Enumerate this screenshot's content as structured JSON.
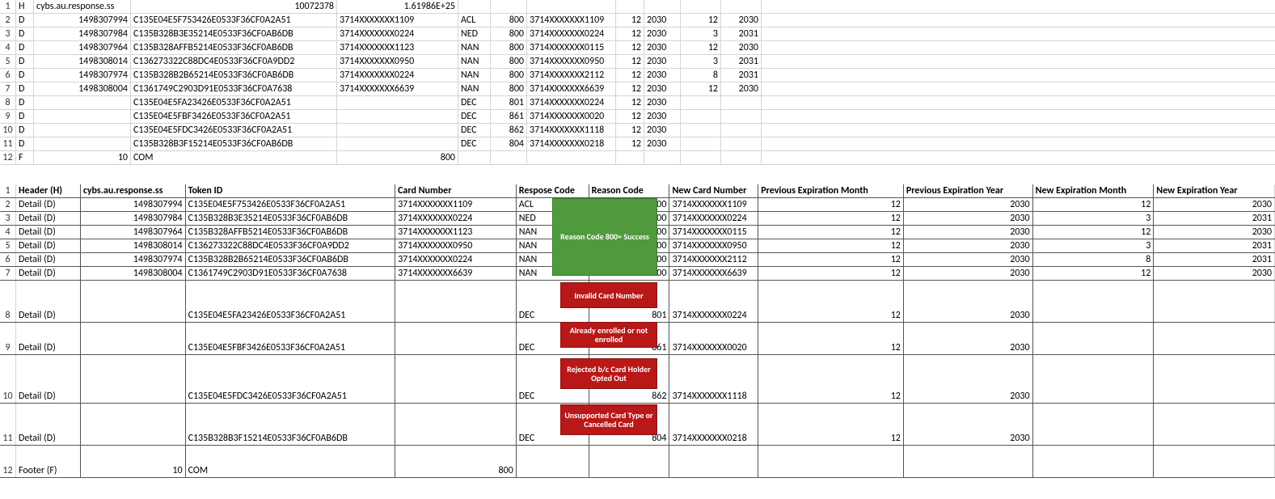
{
  "top": {
    "header": {
      "c1": "H",
      "c2": "cybs.au.response.ss",
      "c3": "10072378",
      "c4": "1.61986E+25"
    },
    "rows": [
      {
        "n": "2",
        "c1": "D",
        "c2": "1498307994",
        "c3": "C135E04E5F753426E0533F36CF0A2A51",
        "c4": "3714XXXXXXX1109",
        "c5": "ACL",
        "c6": "800",
        "c7": "3714XXXXXXX1109",
        "c8": "12",
        "c9": "2030",
        "c10": "12",
        "c11": "2030"
      },
      {
        "n": "3",
        "c1": "D",
        "c2": "1498307984",
        "c3": "C135B328B3E35214E0533F36CF0AB6DB",
        "c4": "3714XXXXXXX0224",
        "c5": "NED",
        "c6": "800",
        "c7": "3714XXXXXXX0224",
        "c8": "12",
        "c9": "2030",
        "c10": "3",
        "c11": "2031"
      },
      {
        "n": "4",
        "c1": "D",
        "c2": "1498307964",
        "c3": "C135B328AFFB5214E0533F36CF0AB6DB",
        "c4": "3714XXXXXXX1123",
        "c5": "NAN",
        "c6": "800",
        "c7": "3714XXXXXXX0115",
        "c8": "12",
        "c9": "2030",
        "c10": "12",
        "c11": "2030"
      },
      {
        "n": "5",
        "c1": "D",
        "c2": "1498308014",
        "c3": "C136273322C88DC4E0533F36CF0A9DD2",
        "c4": "3714XXXXXXX0950",
        "c5": "NAN",
        "c6": "800",
        "c7": "3714XXXXXXX0950",
        "c8": "12",
        "c9": "2030",
        "c10": "3",
        "c11": "2031"
      },
      {
        "n": "6",
        "c1": "D",
        "c2": "1498307974",
        "c3": "C135B328B2B65214E0533F36CF0AB6DB",
        "c4": "3714XXXXXXX0224",
        "c5": "NAN",
        "c6": "800",
        "c7": "3714XXXXXXX2112",
        "c8": "12",
        "c9": "2030",
        "c10": "8",
        "c11": "2031"
      },
      {
        "n": "7",
        "c1": "D",
        "c2": "1498308004",
        "c3": "C1361749C2903D91E0533F36CF0A7638",
        "c4": "3714XXXXXXX6639",
        "c5": "NAN",
        "c6": "800",
        "c7": "3714XXXXXXX6639",
        "c8": "12",
        "c9": "2030",
        "c10": "12",
        "c11": "2030"
      },
      {
        "n": "8",
        "c1": "D",
        "c2": "",
        "c3": "C135E04E5FA23426E0533F36CF0A2A51",
        "c4": "",
        "c5": "DEC",
        "c6": "801",
        "c7": "3714XXXXXXX0224",
        "c8": "12",
        "c9": "2030",
        "c10": "",
        "c11": ""
      },
      {
        "n": "9",
        "c1": "D",
        "c2": "",
        "c3": "C135E04E5FBF3426E0533F36CF0A2A51",
        "c4": "",
        "c5": "DEC",
        "c6": "861",
        "c7": "3714XXXXXXX0020",
        "c8": "12",
        "c9": "2030",
        "c10": "",
        "c11": ""
      },
      {
        "n": "10",
        "c1": "D",
        "c2": "",
        "c3": "C135E04E5FDC3426E0533F36CF0A2A51",
        "c4": "",
        "c5": "DEC",
        "c6": "862",
        "c7": "3714XXXXXXX1118",
        "c8": "12",
        "c9": "2030",
        "c10": "",
        "c11": ""
      },
      {
        "n": "11",
        "c1": "D",
        "c2": "",
        "c3": "C135B328B3F15214E0533F36CF0AB6DB",
        "c4": "",
        "c5": "DEC",
        "c6": "804",
        "c7": "3714XXXXXXX0218",
        "c8": "12",
        "c9": "2030",
        "c10": "",
        "c11": ""
      },
      {
        "n": "12",
        "c1": "F",
        "c2": "10",
        "c3": "COM",
        "c4": "800",
        "c5": "",
        "c6": "",
        "c7": "",
        "c8": "",
        "c9": "",
        "c10": "",
        "c11": ""
      }
    ]
  },
  "bottom": {
    "headers": {
      "c1": "Header (H)",
      "c2": "cybs.au.response.ss",
      "c3": "Token ID",
      "c4": "Card Number",
      "c5": "Respose Code",
      "c6": "Reason Code",
      "c7": "New Card Number",
      "c8": "Previous Expiration Month",
      "c9": "Previous Expiration Year",
      "c10": "New Expiration Month",
      "c11": "New Expiration Year"
    },
    "rows": [
      {
        "n": "2",
        "c1": "Detail (D)",
        "c2": "1498307994",
        "c3": "C135E04E5F753426E0533F36CF0A2A51",
        "c4": "3714XXXXXXX1109",
        "c5": "ACL",
        "c6": "800",
        "c7": "3714XXXXXXX1109",
        "c8": "12",
        "c9": "2030",
        "c10": "12",
        "c11": "2030"
      },
      {
        "n": "3",
        "c1": "Detail (D)",
        "c2": "1498307984",
        "c3": "C135B328B3E35214E0533F36CF0AB6DB",
        "c4": "3714XXXXXXX0224",
        "c5": "NED",
        "c6": "800",
        "c7": "3714XXXXXXX0224",
        "c8": "12",
        "c9": "2030",
        "c10": "3",
        "c11": "2031"
      },
      {
        "n": "4",
        "c1": "Detail (D)",
        "c2": "1498307964",
        "c3": "C135B328AFFB5214E0533F36CF0AB6DB",
        "c4": "3714XXXXXXX1123",
        "c5": "NAN",
        "c6": "800",
        "c7": "3714XXXXXXX0115",
        "c8": "12",
        "c9": "2030",
        "c10": "12",
        "c11": "2030"
      },
      {
        "n": "5",
        "c1": "Detail (D)",
        "c2": "1498308014",
        "c3": "C136273322C88DC4E0533F36CF0A9DD2",
        "c4": "3714XXXXXXX0950",
        "c5": "NAN",
        "c6": "800",
        "c7": "3714XXXXXXX0950",
        "c8": "12",
        "c9": "2030",
        "c10": "3",
        "c11": "2031"
      },
      {
        "n": "6",
        "c1": "Detail (D)",
        "c2": "1498307974",
        "c3": "C135B328B2B65214E0533F36CF0AB6DB",
        "c4": "3714XXXXXXX0224",
        "c5": "NAN",
        "c6": "800",
        "c7": "3714XXXXXXX2112",
        "c8": "12",
        "c9": "2030",
        "c10": "8",
        "c11": "2031"
      },
      {
        "n": "7",
        "c1": "Detail (D)",
        "c2": "1498308004",
        "c3": "C1361749C2903D91E0533F36CF0A7638",
        "c4": "3714XXXXXXX6639",
        "c5": "NAN",
        "c6": "800",
        "c7": "3714XXXXXXX6639",
        "c8": "12",
        "c9": "2030",
        "c10": "12",
        "c11": "2030"
      },
      {
        "n": "8",
        "c1": "Detail (D)",
        "c2": "",
        "c3": "C135E04E5FA23426E0533F36CF0A2A51",
        "c4": "",
        "c5": "DEC",
        "c6": "801",
        "c7": "3714XXXXXXX0224",
        "c8": "12",
        "c9": "2030",
        "c10": "",
        "c11": "",
        "tall": 52
      },
      {
        "n": "9",
        "c1": "Detail (D)",
        "c2": "",
        "c3": "C135E04E5FBF3426E0533F36CF0A2A51",
        "c4": "",
        "c5": "DEC",
        "c6": "861",
        "c7": "3714XXXXXXX0020",
        "c8": "12",
        "c9": "2030",
        "c10": "",
        "c11": "",
        "tall": 40
      },
      {
        "n": "10",
        "c1": "Detail (D)",
        "c2": "",
        "c3": "C135E04E5FDC3426E0533F36CF0A2A51",
        "c4": "",
        "c5": "DEC",
        "c6": "862",
        "c7": "3714XXXXXXX1118",
        "c8": "12",
        "c9": "2030",
        "c10": "",
        "c11": "",
        "tall": 60
      },
      {
        "n": "11",
        "c1": "Detail (D)",
        "c2": "",
        "c3": "C135B328B3F15214E0533F36CF0AB6DB",
        "c4": "",
        "c5": "DEC",
        "c6": "804",
        "c7": "3714XXXXXXX0218",
        "c8": "12",
        "c9": "2030",
        "c10": "",
        "c11": "",
        "tall": 52
      },
      {
        "n": "12",
        "c1": "Footer (F)",
        "c2": "10",
        "c3": "COM",
        "c4": "800",
        "c5": "",
        "c6": "",
        "c7": "",
        "c8": "",
        "c9": "",
        "c10": "",
        "c11": "",
        "tall": 40
      }
    ]
  },
  "callouts": {
    "green": "Reason Code 800= Success",
    "red1": "Invalid Card Number",
    "red2": "Already enrolled or not enrolled",
    "red3": "Rejected b/c Card Holder Opted Out",
    "red4": "Unsupported Card Type or Cancelled Card"
  }
}
